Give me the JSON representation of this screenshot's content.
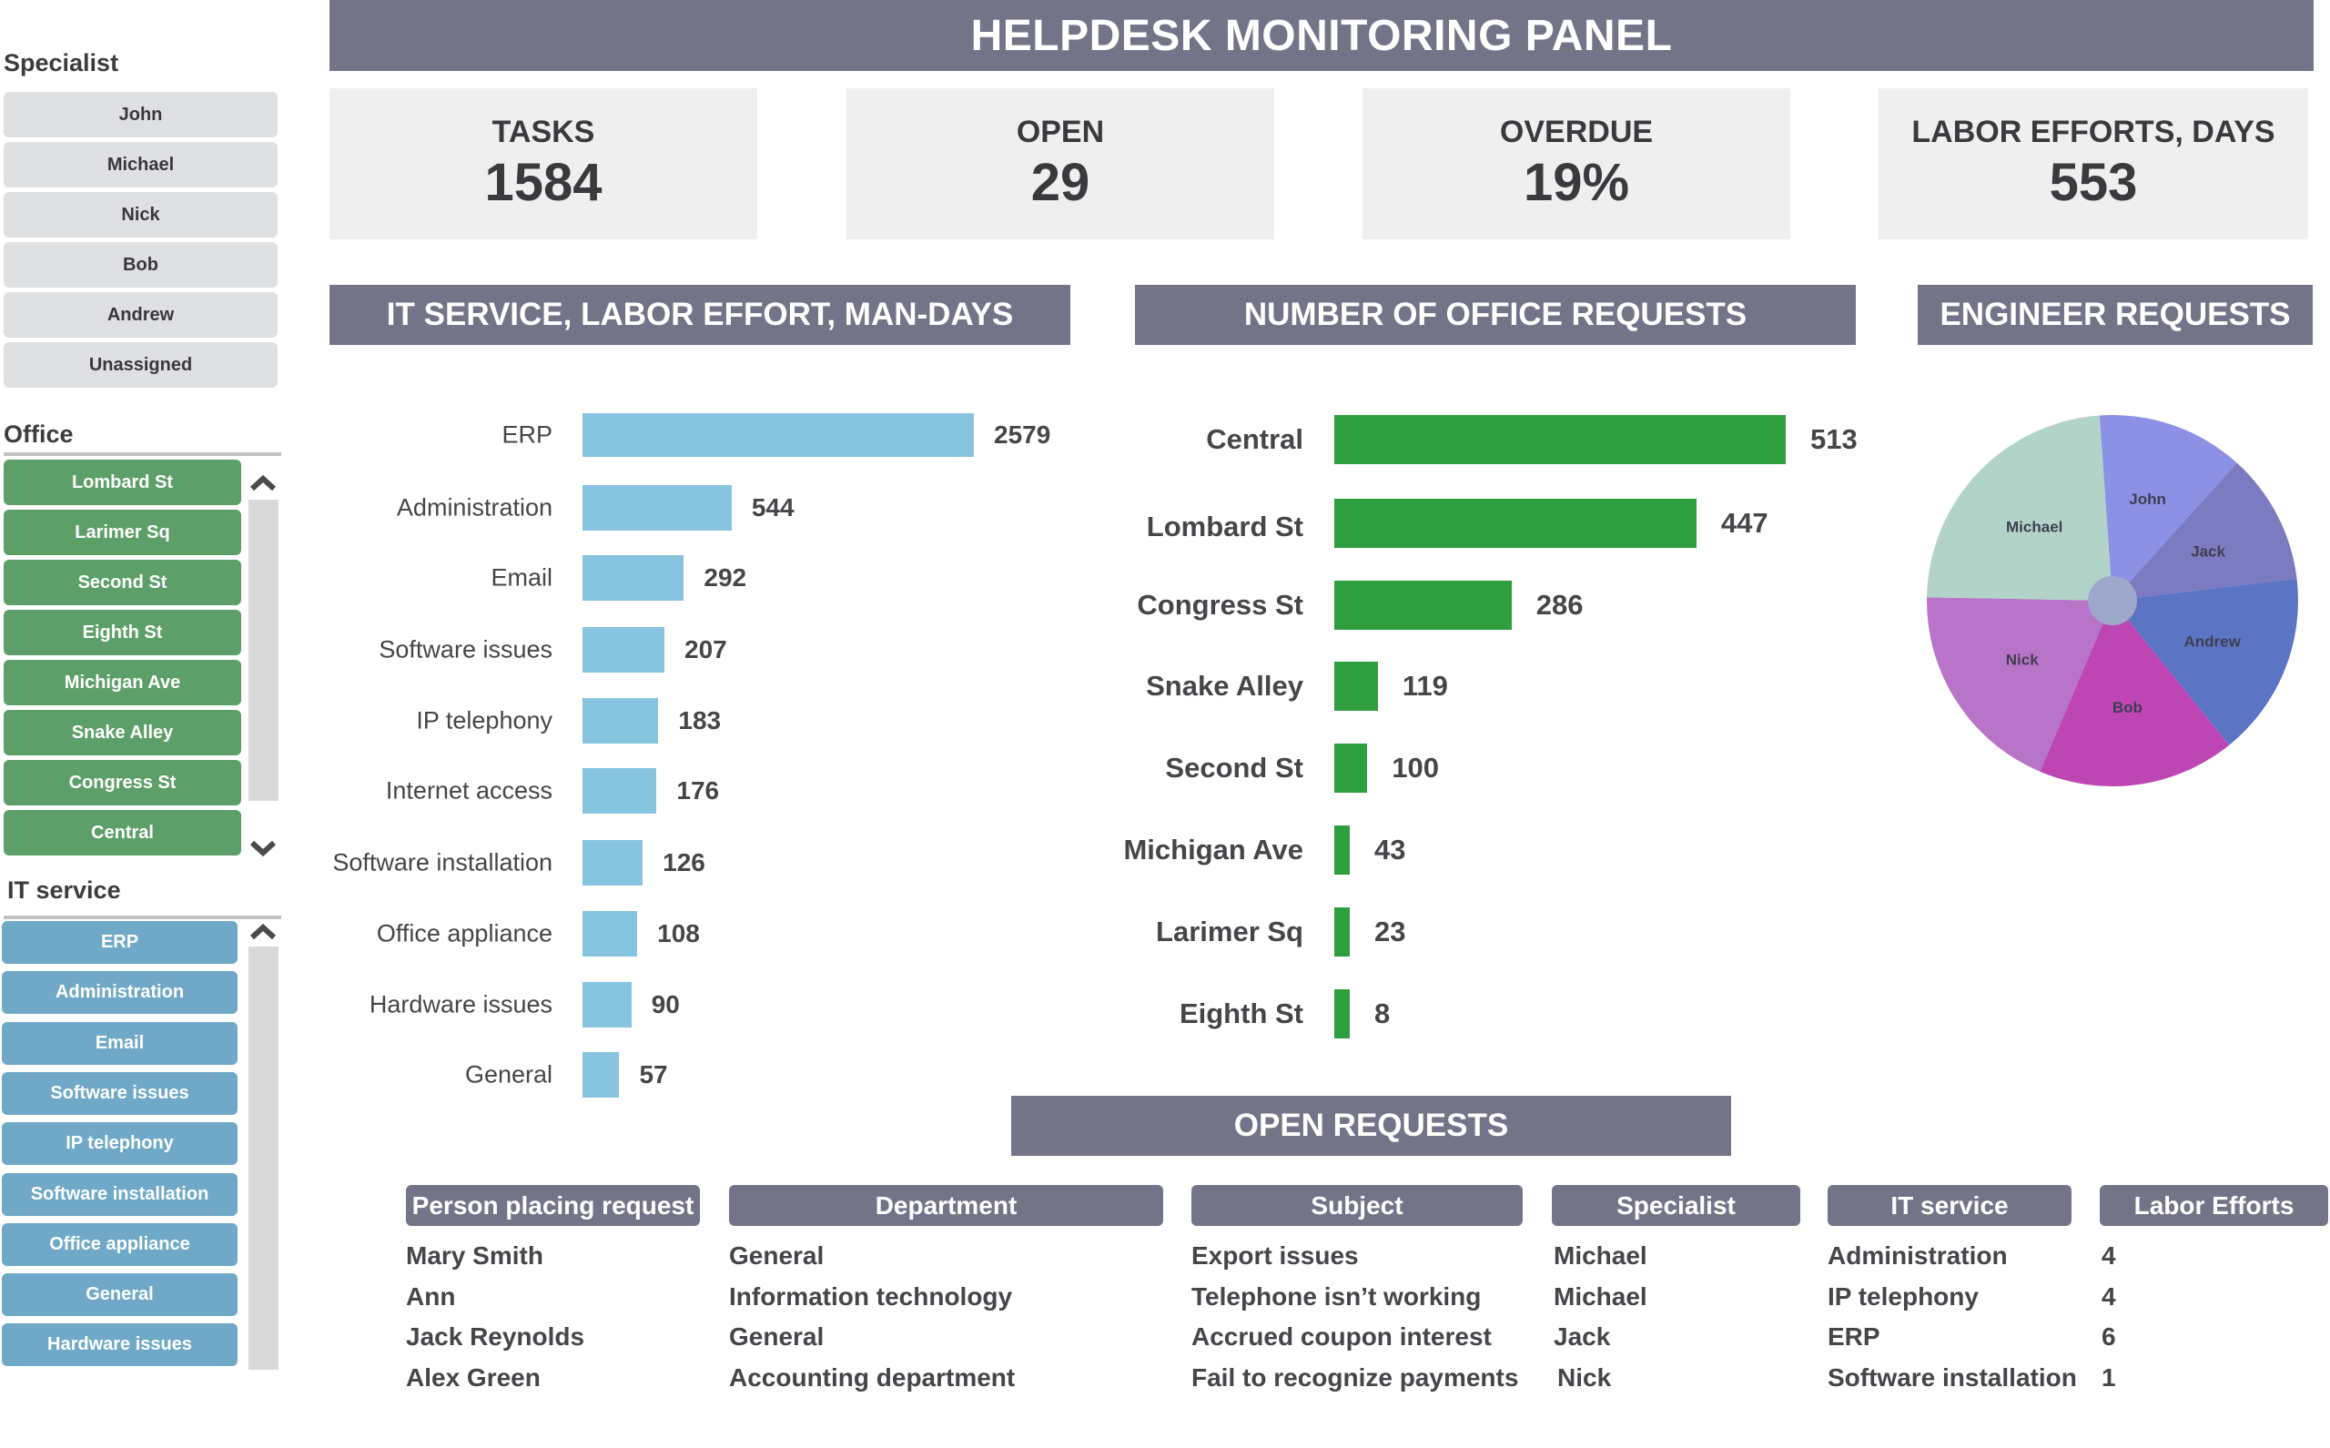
{
  "header": {
    "title": "HELPDESK MONITORING PANEL"
  },
  "sidebar": {
    "specialist": {
      "title": "Specialist",
      "items": [
        "John",
        "Michael",
        "Nick",
        "Bob",
        "Andrew",
        "Unassigned"
      ]
    },
    "office": {
      "title": "Office",
      "items": [
        "Lombard St",
        "Larimer Sq",
        "Second St",
        "Eighth St",
        "Michigan Ave",
        "Snake Alley",
        "Congress St",
        "Central"
      ]
    },
    "it_service": {
      "title": "IT service",
      "items": [
        "ERP",
        "Administration",
        "Email",
        "Software issues",
        "IP telephony",
        "Software installation",
        "Office appliance",
        "General",
        "Hardware issues"
      ]
    }
  },
  "kpis": [
    {
      "label": "TASKS",
      "value": "1584"
    },
    {
      "label": "OPEN",
      "value": "29"
    },
    {
      "label": "OVERDUE",
      "value": "19%"
    },
    {
      "label": "LABOR EFFORTS, DAYS",
      "value": "553"
    }
  ],
  "sections": {
    "it_chart_title": "IT SERVICE, LABOR EFFORT, MAN-DAYS",
    "office_chart_title": "NUMBER OF OFFICE REQUESTS",
    "engineer_chart_title": "ENGINEER REQUESTS",
    "open_requests_title": "OPEN REQUESTS"
  },
  "colors": {
    "header": "#747489",
    "it_bar": "#86c4df",
    "office_bar": "#2f9e3e",
    "office_button": "#5d9f68",
    "it_button": "#6fa9c7",
    "specialist_button": "#dfe0e2"
  },
  "chart_data": [
    {
      "type": "bar",
      "orientation": "horizontal",
      "title": "IT SERVICE, LABOR EFFORT, MAN-DAYS",
      "categories": [
        "ERP",
        "Administration",
        "Email",
        "Software issues",
        "IP telephony",
        "Internet access",
        "Software installation",
        "Office appliance",
        "Hardware issues",
        "General"
      ],
      "values": [
        2579,
        544,
        292,
        207,
        183,
        176,
        126,
        108,
        90,
        57
      ],
      "xlabel": "",
      "ylabel": "",
      "data_labels": true,
      "grid": false
    },
    {
      "type": "bar",
      "orientation": "horizontal",
      "title": "NUMBER OF OFFICE REQUESTS",
      "categories": [
        "Central",
        "Lombard St",
        "Congress St",
        "Snake Alley",
        "Second St",
        "Michigan Ave",
        "Larimer Sq",
        "Eighth St"
      ],
      "values": [
        513,
        447,
        286,
        119,
        100,
        43,
        23,
        8
      ],
      "xlabel": "",
      "ylabel": "",
      "data_labels": true,
      "grid": false
    },
    {
      "type": "pie",
      "title": "ENGINEER REQUESTS",
      "categories": [
        "John",
        "Jack",
        "Andrew",
        "Bob",
        "Nick",
        "Michael"
      ],
      "values": [
        12.8,
        11.4,
        16.1,
        17.2,
        18.9,
        23.6
      ],
      "units": "percent (estimated from slice angles)",
      "colors": [
        "#8d91e6",
        "#7b7bc2",
        "#5c74c4",
        "#bd46b4",
        "#b774c9",
        "#b2d4c8"
      ],
      "legend": "inline-labels"
    }
  ],
  "open_requests": {
    "columns": [
      "Person placing request",
      "Department",
      "Subject",
      "Specialist",
      "IT service",
      "Labor Efforts"
    ],
    "rows": [
      [
        "Mary Smith",
        "General",
        "Export issues",
        "Michael",
        "Administration",
        "4"
      ],
      [
        "Ann",
        "Information technology",
        "Telephone isn’t working",
        "Michael",
        "IP telephony",
        "4"
      ],
      [
        "Jack Reynolds",
        "General",
        "Accrued coupon interest",
        "Jack",
        "ERP",
        "6"
      ],
      [
        "Alex Green",
        "Accounting department",
        "Fail to recognize payments",
        "Nick",
        "Software installation",
        "1"
      ]
    ]
  }
}
